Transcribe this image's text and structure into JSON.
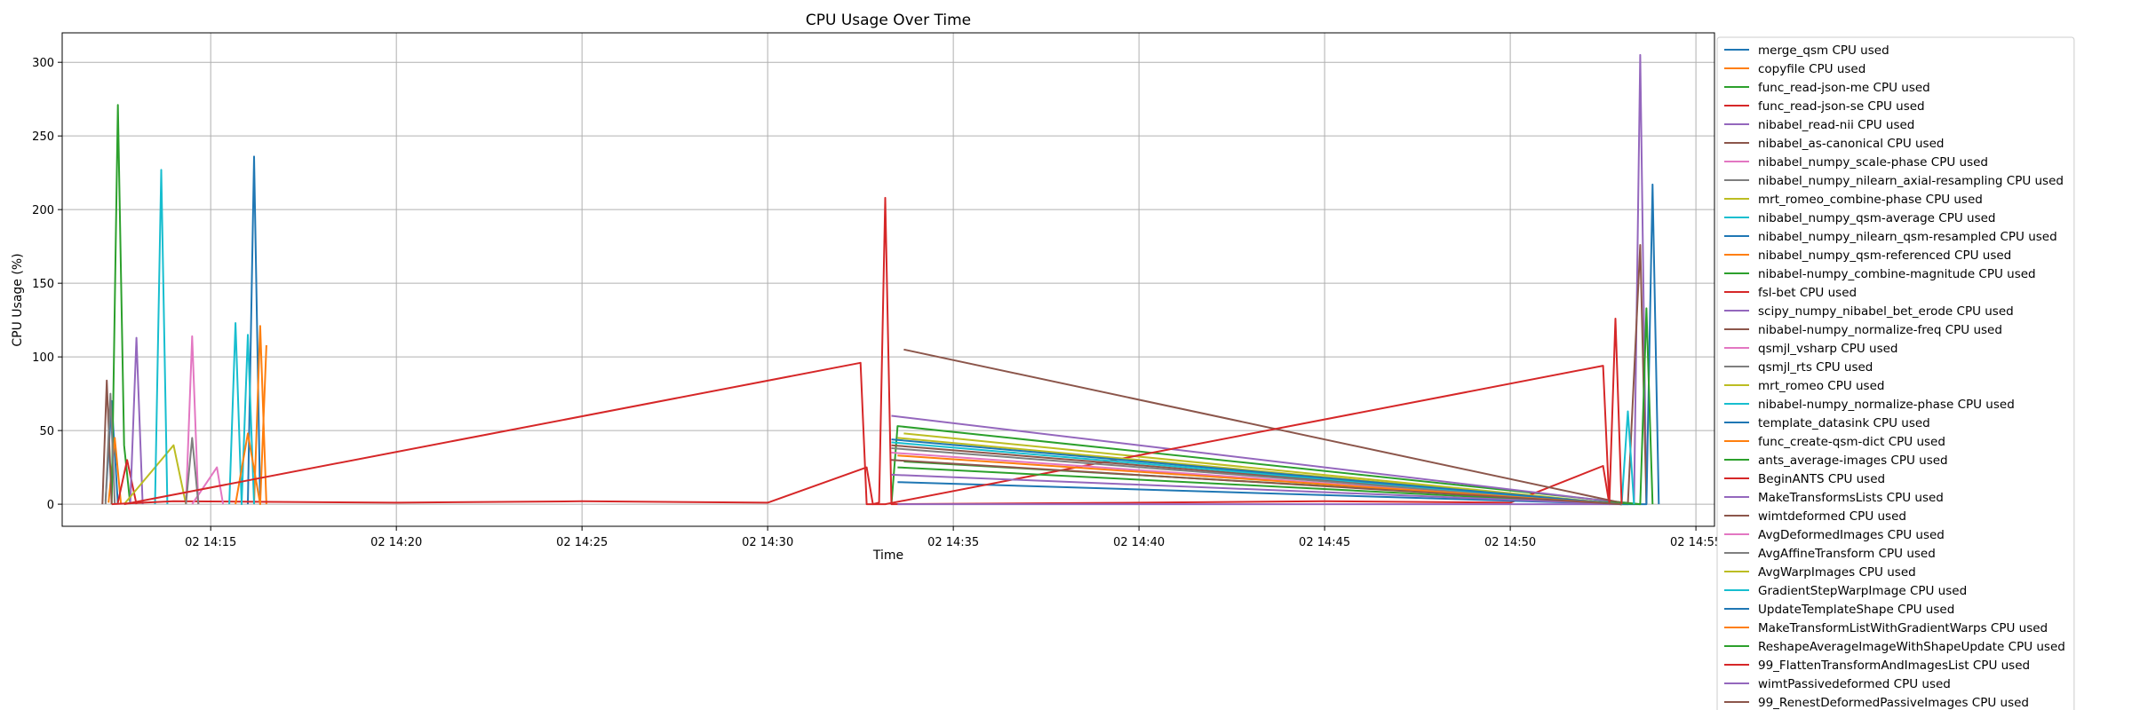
{
  "chart_data": {
    "type": "line",
    "title": "CPU Usage Over Time",
    "xlabel": "Time",
    "ylabel": "CPU Usage (%)",
    "x_ticks": [
      "02 14:15",
      "02 14:20",
      "02 14:25",
      "02 14:30",
      "02 14:35",
      "02 14:40",
      "02 14:45",
      "02 14:50",
      "02 14:55"
    ],
    "y_ticks": [
      0,
      50,
      100,
      150,
      200,
      250,
      300
    ],
    "xlim": [
      "14:11:00",
      "14:55:30"
    ],
    "ylim": [
      -15,
      320
    ],
    "grid": true,
    "legend_position": "outside right",
    "series": [
      {
        "name": "merge_qsm CPU used",
        "color": "#1f77b4",
        "x": [
          "14:12:10",
          "14:12:20",
          "14:12:30"
        ],
        "y": [
          2,
          70,
          0
        ]
      },
      {
        "name": "copyfile CPU used",
        "color": "#ff7f0e",
        "x": [
          "14:12:15",
          "14:12:25",
          "14:12:35"
        ],
        "y": [
          1,
          45,
          0
        ]
      },
      {
        "name": "func_read-json-me CPU used",
        "color": "#2ca02c",
        "x": [
          "14:12:20",
          "14:12:30",
          "14:12:40",
          "14:12:50"
        ],
        "y": [
          0,
          271,
          40,
          0
        ]
      },
      {
        "name": "func_read-json-se CPU used",
        "color": "#d62728",
        "x": [
          "14:12:30",
          "14:12:45",
          "14:13:00"
        ],
        "y": [
          1,
          30,
          0
        ]
      },
      {
        "name": "nibabel_read-nii CPU used",
        "color": "#9467bd",
        "x": [
          "14:12:50",
          "14:13:00",
          "14:13:10"
        ],
        "y": [
          0,
          113,
          0
        ]
      },
      {
        "name": "nibabel_as-canonical CPU used",
        "color": "#8c564b",
        "x": [
          "14:12:05",
          "14:12:12",
          "14:12:20"
        ],
        "y": [
          0,
          84,
          0
        ]
      },
      {
        "name": "nibabel_numpy_scale-phase CPU used",
        "color": "#e377c2",
        "x": [
          "14:14:20",
          "14:14:30",
          "14:14:40"
        ],
        "y": [
          0,
          114,
          0
        ]
      },
      {
        "name": "nibabel_numpy_nilearn_axial-resampling CPU used",
        "color": "#7f7f7f",
        "x": [
          "14:12:10",
          "14:12:18",
          "14:12:25"
        ],
        "y": [
          0,
          75,
          0
        ]
      },
      {
        "name": "mrt_romeo_combine-phase CPU used",
        "color": "#bcbd22",
        "x": [
          "14:12:40",
          "14:14:00",
          "14:14:20"
        ],
        "y": [
          0,
          40,
          0
        ]
      },
      {
        "name": "nibabel_numpy_qsm-average CPU used",
        "color": "#17becf",
        "x": [
          "14:13:30",
          "14:13:40",
          "14:13:50"
        ],
        "y": [
          0,
          227,
          0
        ]
      },
      {
        "name": "nibabel_numpy_nilearn_qsm-resampled CPU used",
        "color": "#1f77b4",
        "x": [
          "14:16:00",
          "14:16:10",
          "14:16:20"
        ],
        "y": [
          0,
          236,
          0
        ]
      },
      {
        "name": "nibabel_numpy_qsm-referenced CPU used",
        "color": "#ff7f0e",
        "x": [
          "14:16:10",
          "14:16:20",
          "14:16:30"
        ],
        "y": [
          0,
          121,
          0
        ]
      },
      {
        "name": "nibabel-numpy_combine-magnitude CPU used",
        "color": "#2ca02c",
        "x": [
          "14:33:20",
          "14:33:30",
          "14:53:30"
        ],
        "y": [
          0,
          53,
          0
        ]
      },
      {
        "name": "fsl-bet CPU used",
        "color": "#d62728",
        "x": [
          "14:12:20",
          "14:14:00",
          "14:20:00",
          "14:25:00",
          "14:30:00",
          "14:32:40",
          "14:32:50",
          "14:33:00",
          "14:33:10",
          "14:33:20",
          "14:40:00",
          "14:45:00",
          "14:50:00",
          "14:52:30",
          "14:52:40",
          "14:53:00"
        ],
        "y": [
          0,
          2,
          1,
          2,
          1,
          25,
          0,
          1,
          208,
          0,
          1,
          2,
          1,
          26,
          0,
          1
        ]
      },
      {
        "name": "scipy_numpy_nibabel_bet_erode CPU used",
        "color": "#9467bd",
        "x": [
          "14:33:20",
          "14:53:20",
          "14:53:30",
          "14:53:40"
        ],
        "y": [
          60,
          0,
          305,
          0
        ]
      },
      {
        "name": "nibabel-numpy_normalize-freq CPU used",
        "color": "#8c564b",
        "x": [
          "14:33:40",
          "14:53:10",
          "14:53:30",
          "14:53:40"
        ],
        "y": [
          105,
          0,
          176,
          0
        ]
      },
      {
        "name": "qsmjl_vsharp CPU used",
        "color": "#e377c2",
        "x": [
          "14:14:30",
          "14:15:10",
          "14:15:20"
        ],
        "y": [
          0,
          25,
          0
        ]
      },
      {
        "name": "qsmjl_rts CPU used",
        "color": "#7f7f7f",
        "x": [
          "14:14:20",
          "14:14:30",
          "14:14:40"
        ],
        "y": [
          0,
          45,
          0
        ]
      },
      {
        "name": "mrt_romeo CPU used",
        "color": "#bcbd22",
        "x": [
          "14:33:40",
          "14:53:00",
          "14:53:10"
        ],
        "y": [
          48,
          0,
          0
        ]
      },
      {
        "name": "nibabel-numpy_normalize-phase CPU used",
        "color": "#17becf",
        "x": [
          "14:15:30",
          "14:15:40",
          "14:15:50",
          "14:16:00",
          "14:16:10"
        ],
        "y": [
          0,
          123,
          0,
          115,
          0
        ]
      },
      {
        "name": "template_datasink CPU used",
        "color": "#1f77b4",
        "x": [
          "14:33:30",
          "14:53:00",
          "14:53:40",
          "14:53:50",
          "14:54:00"
        ],
        "y": [
          15,
          0,
          0,
          217,
          0
        ]
      },
      {
        "name": "func_create-qsm-dict CPU used",
        "color": "#ff7f0e",
        "x": [
          "14:15:40",
          "14:16:00",
          "14:16:20",
          "14:16:30"
        ],
        "y": [
          0,
          48,
          0,
          108
        ]
      },
      {
        "name": "ants_average-images CPU used",
        "color": "#2ca02c",
        "x": [
          "14:33:40",
          "14:53:30",
          "14:53:40",
          "14:53:50"
        ],
        "y": [
          29,
          0,
          133,
          0
        ]
      },
      {
        "name": "BeginANTS CPU used",
        "color": "#d62728",
        "x": [
          "14:12:40",
          "14:32:30",
          "14:32:40",
          "14:33:10",
          "14:52:30",
          "14:52:40"
        ],
        "y": [
          0,
          96,
          0,
          0,
          94,
          0
        ]
      },
      {
        "name": "MakeTransformsLists CPU used",
        "color": "#9467bd",
        "x": [
          "14:33:30",
          "14:53:00"
        ],
        "y": [
          0,
          0
        ]
      },
      {
        "name": "wimtdeformed CPU used",
        "color": "#8c564b",
        "x": [
          "14:33:20",
          "14:53:00"
        ],
        "y": [
          40,
          0
        ]
      },
      {
        "name": "AvgDeformedImages CPU used",
        "color": "#e377c2",
        "x": [
          "14:33:20",
          "14:53:00"
        ],
        "y": [
          35,
          0
        ]
      },
      {
        "name": "AvgAffineTransform CPU used",
        "color": "#7f7f7f",
        "x": [
          "14:33:20",
          "14:53:00"
        ],
        "y": [
          38,
          0
        ]
      },
      {
        "name": "AvgWarpImages CPU used",
        "color": "#bcbd22",
        "x": [
          "14:33:30",
          "14:53:00"
        ],
        "y": [
          45,
          0
        ]
      },
      {
        "name": "GradientStepWarpImage CPU used",
        "color": "#17becf",
        "x": [
          "14:33:20",
          "14:53:00",
          "14:53:10",
          "14:53:20"
        ],
        "y": [
          42,
          0,
          63,
          0
        ]
      },
      {
        "name": "UpdateTemplateShape CPU used",
        "color": "#1f77b4",
        "x": [
          "14:33:20",
          "14:53:00"
        ],
        "y": [
          44,
          0
        ]
      },
      {
        "name": "MakeTransformListWithGradientWarps CPU used",
        "color": "#ff7f0e",
        "x": [
          "14:33:30",
          "14:53:00"
        ],
        "y": [
          33,
          0
        ]
      },
      {
        "name": "ReshapeAverageImageWithShapeUpdate CPU used",
        "color": "#2ca02c",
        "x": [
          "14:33:30",
          "14:53:00"
        ],
        "y": [
          25,
          0
        ]
      },
      {
        "name": "99_FlattenTransformAndImagesList CPU used",
        "color": "#d62728",
        "x": [
          "14:52:40",
          "14:52:50",
          "14:53:00"
        ],
        "y": [
          0,
          126,
          0
        ]
      },
      {
        "name": "wimtPassivedeformed CPU used",
        "color": "#9467bd",
        "x": [
          "14:33:20",
          "14:53:00"
        ],
        "y": [
          20,
          0
        ]
      },
      {
        "name": "99_RenestDeformedPassiveImages CPU used",
        "color": "#8c564b",
        "x": [
          "14:33:20",
          "14:53:00"
        ],
        "y": [
          30,
          0
        ]
      }
    ]
  }
}
